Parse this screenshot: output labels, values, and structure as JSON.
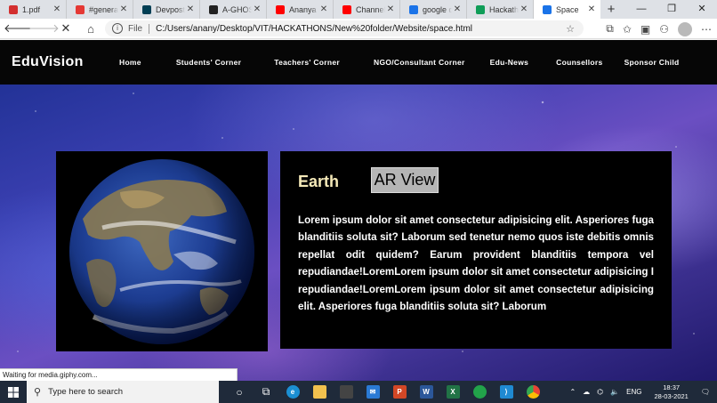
{
  "browser": {
    "tabs": [
      {
        "title": "1.pdf",
        "icon_color": "#d32f2f",
        "icon": "pdf-icon"
      },
      {
        "title": "#general",
        "icon_color": "#e53935",
        "icon": "slack-icon"
      },
      {
        "title": "Devpost",
        "icon_color": "#003e54",
        "icon": "devpost-icon"
      },
      {
        "title": "A-GHOSH",
        "icon_color": "#222222",
        "icon": "github-icon"
      },
      {
        "title": "Ananya G",
        "icon_color": "#ff0000",
        "icon": "youtube-icon"
      },
      {
        "title": "Channel c",
        "icon_color": "#ff0000",
        "icon": "youtube-icon"
      },
      {
        "title": "google dr",
        "icon_color": "#1a73e8",
        "icon": "bing-icon"
      },
      {
        "title": "Hackatho",
        "icon_color": "#0f9d58",
        "icon": "drive-icon"
      },
      {
        "title": "Space",
        "icon_color": "#1a73e8",
        "icon": "loading-icon",
        "active": true
      }
    ],
    "new_tab": "+",
    "window_controls": {
      "minimize": "—",
      "restore": "❐",
      "close": "✕"
    },
    "address": {
      "scheme": "File",
      "url": "C:/Users/anany/Desktop/VIT/HACKATHONS/New%20folder/Website/space.html"
    },
    "status_text": "Waiting for media.giphy.com..."
  },
  "site": {
    "brand": "EduVision",
    "nav": [
      "Home",
      "Students' Corner",
      "Teachers' Corner",
      "NGO/Consultant Corner",
      "Edu-News",
      "Counsellors",
      "Sponsor Child"
    ],
    "planet": {
      "name": "Earth",
      "ar_button": "AR View",
      "description": "Lorem ipsum dolor sit amet consectetur adipisicing elit. Asperiores fuga blanditiis soluta sit? Laborum sed tenetur nemo quos iste debitis omnis repellat odit quidem? Earum provident blanditiis tempora vel repudiandae!LoremLorem ipsum dolor sit amet consectetur adipisicing I repudiandae!LoremLorem ipsum dolor sit amet consectetur adipisicing elit. Asperiores fuga blanditiis soluta sit? Laborum"
    }
  },
  "taskbar": {
    "search_placeholder": "Type here to search",
    "language": "ENG",
    "time": "18:37",
    "date": "28-03-2021"
  }
}
